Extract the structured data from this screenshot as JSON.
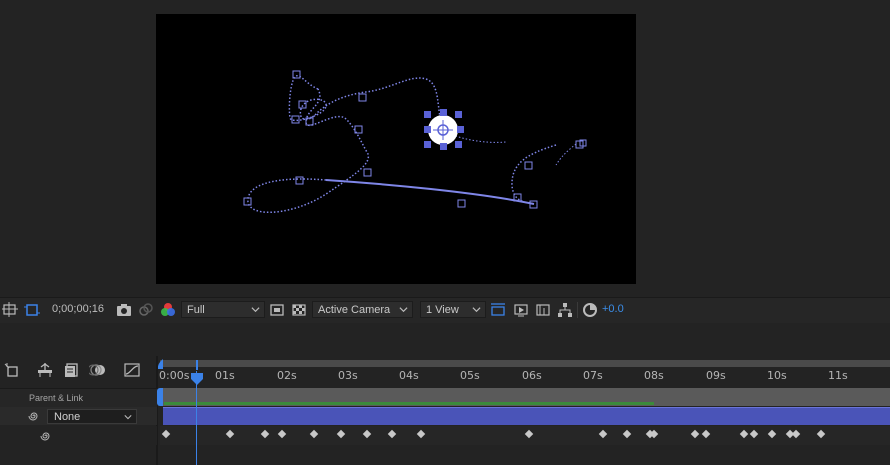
{
  "viewer": {
    "toolbar": {
      "timecode": "0;00;00;16",
      "resolution": "Full",
      "camera": "Active Camera",
      "views": "1 View",
      "exposure": "+0.0"
    }
  },
  "timeline": {
    "ruler_labels": [
      "0:00s",
      "01s",
      "02s",
      "03s",
      "04s",
      "05s",
      "06s",
      "07s",
      "08s",
      "09s",
      "10s",
      "11s"
    ],
    "column_header": "Parent & Link",
    "parent_value": "None"
  },
  "colors": {
    "path": "#7f86e8",
    "accent": "#3b82e8",
    "layer_bar": "#4a54b8",
    "work_area_green": "#3b8b3b"
  },
  "icons": {
    "toolbar": [
      "region-of-interest-icon",
      "transparency-grid-icon",
      "snapshot-camera-icon",
      "show-snapshot-icon",
      "color-channels-icon",
      "fast-previews-icon",
      "timeline-icon",
      "flowchart-icon",
      "reset-exposure-icon"
    ],
    "timeline": [
      "comp-mini-flowchart-icon",
      "draft-3d-icon",
      "shy-layers-icon",
      "frame-blending-icon",
      "motion-blur-icon",
      "graph-editor-icon",
      "pickwhip-icon"
    ]
  }
}
